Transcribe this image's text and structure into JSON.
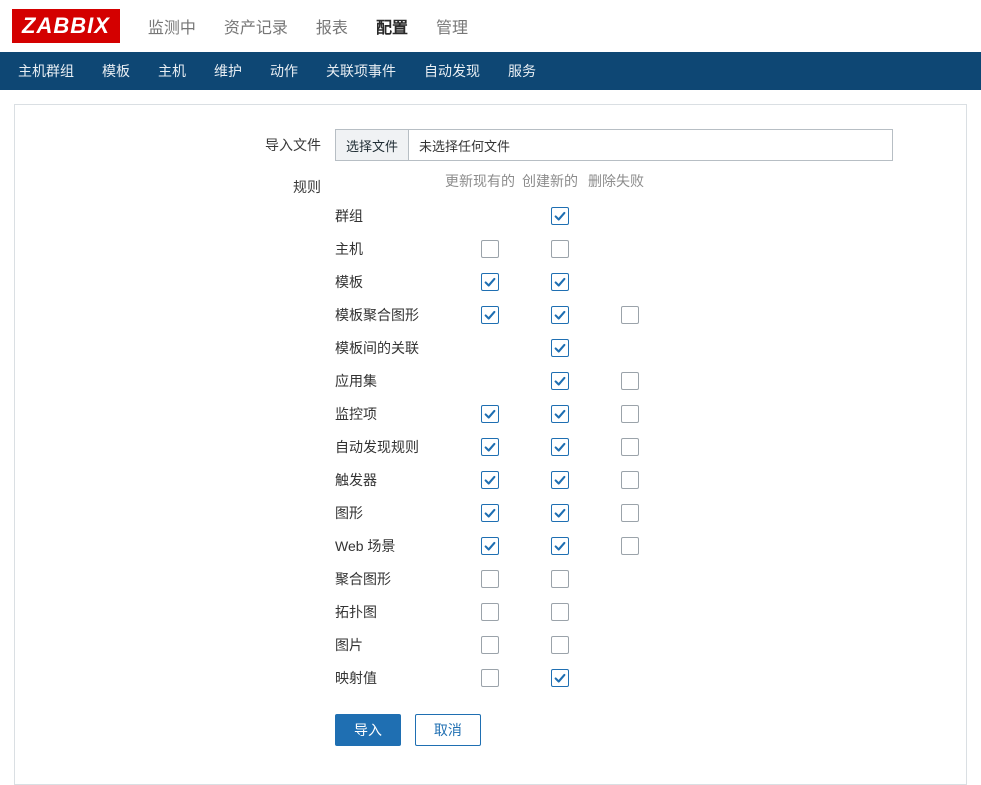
{
  "logo_text": "ZABBIX",
  "top_menu": [
    {
      "label": "监测中",
      "active": false
    },
    {
      "label": "资产记录",
      "active": false
    },
    {
      "label": "报表",
      "active": false
    },
    {
      "label": "配置",
      "active": true
    },
    {
      "label": "管理",
      "active": false
    }
  ],
  "sub_menu": [
    {
      "label": "主机群组"
    },
    {
      "label": "模板"
    },
    {
      "label": "主机"
    },
    {
      "label": "维护"
    },
    {
      "label": "动作"
    },
    {
      "label": "关联项事件"
    },
    {
      "label": "自动发现"
    },
    {
      "label": "服务"
    }
  ],
  "form": {
    "file_label": "导入文件",
    "file_button": "选择文件",
    "file_placeholder": "未选择任何文件",
    "rules_label": "规则",
    "rules_headers": {
      "update": "更新现有的",
      "create": "创建新的",
      "delete": "删除失败"
    },
    "rules": [
      {
        "name": "群组",
        "update": null,
        "create": true,
        "delete": null
      },
      {
        "name": "主机",
        "update": false,
        "create": false,
        "delete": null
      },
      {
        "name": "模板",
        "update": true,
        "create": true,
        "delete": null
      },
      {
        "name": "模板聚合图形",
        "update": true,
        "create": true,
        "delete": false
      },
      {
        "name": "模板间的关联",
        "update": null,
        "create": true,
        "delete": null
      },
      {
        "name": "应用集",
        "update": null,
        "create": true,
        "delete": false
      },
      {
        "name": "监控项",
        "update": true,
        "create": true,
        "delete": false
      },
      {
        "name": "自动发现规则",
        "update": true,
        "create": true,
        "delete": false
      },
      {
        "name": "触发器",
        "update": true,
        "create": true,
        "delete": false
      },
      {
        "name": "图形",
        "update": true,
        "create": true,
        "delete": false
      },
      {
        "name": "Web 场景",
        "update": true,
        "create": true,
        "delete": false
      },
      {
        "name": "聚合图形",
        "update": false,
        "create": false,
        "delete": null
      },
      {
        "name": "拓扑图",
        "update": false,
        "create": false,
        "delete": null
      },
      {
        "name": "图片",
        "update": false,
        "create": false,
        "delete": null
      },
      {
        "name": "映射值",
        "update": false,
        "create": true,
        "delete": null
      }
    ],
    "submit": "导入",
    "cancel": "取消"
  }
}
